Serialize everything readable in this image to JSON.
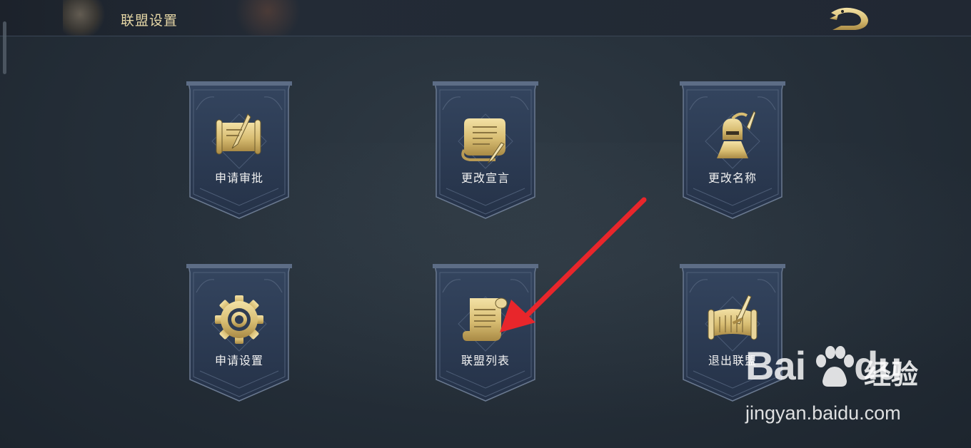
{
  "header": {
    "title": "联盟设置",
    "back_icon": "dragon-back-icon"
  },
  "cards": [
    {
      "label": "申请审批",
      "icon": "scroll-brush-icon"
    },
    {
      "label": "更改宣言",
      "icon": "parchment-quill-icon"
    },
    {
      "label": "更改名称",
      "icon": "warrior-helmet-icon"
    },
    {
      "label": "申请设置",
      "icon": "gear-icon"
    },
    {
      "label": "联盟列表",
      "icon": "scroll-list-icon"
    },
    {
      "label": "退出联盟",
      "icon": "map-scroll-sword-icon"
    }
  ],
  "annotation": {
    "arrow_color": "#e8262b"
  },
  "watermark": {
    "logo_text_a": "Bai",
    "logo_text_b": "du",
    "logo_cn": "经验",
    "url": "jingyan.baidu.com"
  },
  "colors": {
    "accent_gold": "#d9c07a",
    "card_bg": "#2d3c55",
    "title_text": "#e6d7a6"
  }
}
